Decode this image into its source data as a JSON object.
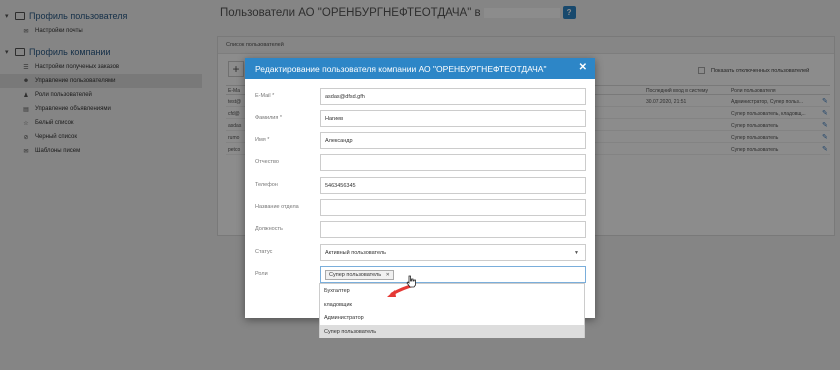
{
  "sidebar": {
    "profile_user": "Профиль пользователя",
    "profile_user_items": [
      {
        "label": "Настройки почты",
        "icon": "mail-icon",
        "glyph": "✉"
      }
    ],
    "profile_company": "Профиль компании",
    "profile_company_items": [
      {
        "label": "Настройки полученых заказов",
        "icon": "sliders-icon",
        "glyph": "☰"
      },
      {
        "label": "Управление пользователями",
        "icon": "users-icon",
        "glyph": "☻",
        "active": true
      },
      {
        "label": "Роли пользователей",
        "icon": "roles-icon",
        "glyph": "♟"
      },
      {
        "label": "Управление объявлениями",
        "icon": "ads-icon",
        "glyph": "▤"
      },
      {
        "label": "Белый список",
        "icon": "star-icon",
        "glyph": "☆"
      },
      {
        "label": "Черный список",
        "icon": "ban-icon",
        "glyph": "⊘"
      },
      {
        "label": "Шаблоны писем",
        "icon": "envelope-icon",
        "glyph": "✉"
      }
    ]
  },
  "page": {
    "title": "Пользователи АО \"ОРЕНБУРГНЕФТЕОТДАЧА\" в",
    "help": "?"
  },
  "panel": {
    "title": "Список пользователей",
    "add_label": "+",
    "show_disabled": "Показать отключенных пользователей",
    "col_email": "E-Ма",
    "col_last_login": "Последний вход в систему",
    "col_roles": "Роли пользователя",
    "rows": [
      {
        "email": "test@",
        "last_login": "30.07.2020, 21:51",
        "roles": "Администратор, Супер польз..."
      },
      {
        "email": "cfd@",
        "last_login": "",
        "roles": "Супер пользователь, кладовщ..."
      },
      {
        "email": "asdas",
        "last_login": "",
        "roles": "Супер пользователь"
      },
      {
        "email": "rumo",
        "last_login": "",
        "roles": "Супер пользователь"
      },
      {
        "email": "petco",
        "last_login": "",
        "roles": "Супер пользователь"
      }
    ]
  },
  "modal": {
    "title": "Редактирование пользователя компании АО \"ОРЕНБУРГНЕФТЕОТДАЧА\"",
    "close": "✕",
    "fields": {
      "email": {
        "label": "E-Mail *",
        "value": "asdas@dfsd.gfh"
      },
      "last_name": {
        "label": "Фамилия *",
        "value": "Нагиев"
      },
      "first_name": {
        "label": "Имя *",
        "value": "Александр"
      },
      "middle_name": {
        "label": "Отчество",
        "value": ""
      },
      "phone": {
        "label": "Телефон",
        "value": "5463456345"
      },
      "department": {
        "label": "Название отдела",
        "value": ""
      },
      "position": {
        "label": "Должность",
        "value": ""
      },
      "status": {
        "label": "Статус",
        "value": "Активный пользователь"
      },
      "roles": {
        "label": "Роли",
        "selected_tag": "Супер пользователь",
        "tag_remove": "✕"
      }
    },
    "dropdown_options": [
      "Бухгалтер",
      "кладовщик",
      "Администратор",
      "Супер пользователь"
    ]
  },
  "colors": {
    "primary": "#2d86c7",
    "annotation_arrow": "#e53935"
  }
}
